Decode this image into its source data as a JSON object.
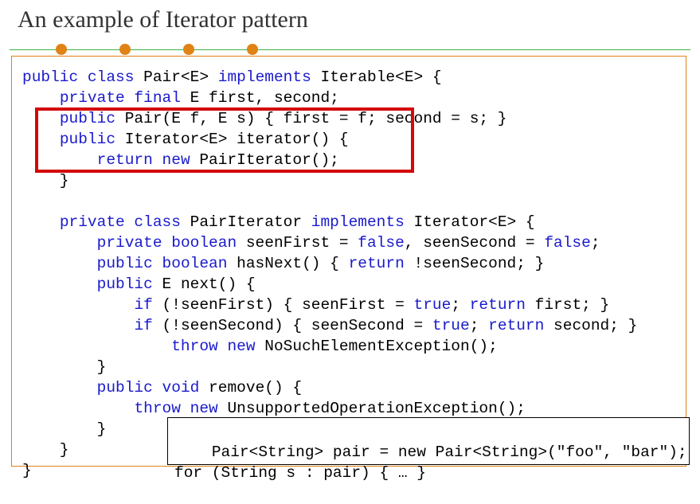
{
  "title": "An example of Iterator pattern",
  "code": {
    "lines": [
      {
        "indent": 0,
        "segs": [
          [
            "public class",
            "kw"
          ],
          [
            " Pair<E> ",
            "plain"
          ],
          [
            "implements",
            "kw"
          ],
          [
            " Iterable<E> {",
            "plain"
          ]
        ]
      },
      {
        "indent": 1,
        "segs": [
          [
            "private final",
            "kw"
          ],
          [
            " E first, second;",
            "plain"
          ]
        ]
      },
      {
        "indent": 1,
        "segs": [
          [
            "public",
            "kw"
          ],
          [
            " Pair(E f, E s) { first = f; second = s; }",
            "plain"
          ]
        ]
      },
      {
        "indent": 1,
        "segs": [
          [
            "public",
            "kw"
          ],
          [
            " Iterator<E> iterator() {",
            "plain"
          ]
        ]
      },
      {
        "indent": 2,
        "segs": [
          [
            "return new",
            "kw"
          ],
          [
            " PairIterator();",
            "plain"
          ]
        ]
      },
      {
        "indent": 1,
        "segs": [
          [
            "}",
            "plain"
          ]
        ]
      },
      {
        "indent": 0,
        "segs": [
          [
            "",
            "plain"
          ]
        ]
      },
      {
        "indent": 1,
        "segs": [
          [
            "private class",
            "kw"
          ],
          [
            " PairIterator ",
            "plain"
          ],
          [
            "implements",
            "kw"
          ],
          [
            " Iterator<E> {",
            "plain"
          ]
        ]
      },
      {
        "indent": 2,
        "segs": [
          [
            "private boolean",
            "kw"
          ],
          [
            " seenFirst = ",
            "plain"
          ],
          [
            "false",
            "kw"
          ],
          [
            ", seenSecond = ",
            "plain"
          ],
          [
            "false",
            "kw"
          ],
          [
            ";",
            "plain"
          ]
        ]
      },
      {
        "indent": 2,
        "segs": [
          [
            "public boolean",
            "kw"
          ],
          [
            " hasNext() { ",
            "plain"
          ],
          [
            "return",
            "kw"
          ],
          [
            " !seenSecond; }",
            "plain"
          ]
        ]
      },
      {
        "indent": 2,
        "segs": [
          [
            "public",
            "kw"
          ],
          [
            " E next() {",
            "plain"
          ]
        ]
      },
      {
        "indent": 3,
        "segs": [
          [
            "if",
            "kw"
          ],
          [
            " (!seenFirst) { seenFirst = ",
            "plain"
          ],
          [
            "true",
            "kw"
          ],
          [
            "; ",
            "plain"
          ],
          [
            "return",
            "kw"
          ],
          [
            " first; }",
            "plain"
          ]
        ]
      },
      {
        "indent": 3,
        "segs": [
          [
            "if",
            "kw"
          ],
          [
            " (!seenSecond) { seenSecond = ",
            "plain"
          ],
          [
            "true",
            "kw"
          ],
          [
            "; ",
            "plain"
          ],
          [
            "return",
            "kw"
          ],
          [
            " second; }",
            "plain"
          ]
        ]
      },
      {
        "indent": 4,
        "segs": [
          [
            "throw new",
            "kw"
          ],
          [
            " NoSuchElementException();",
            "plain"
          ]
        ]
      },
      {
        "indent": 2,
        "segs": [
          [
            "}",
            "plain"
          ]
        ]
      },
      {
        "indent": 2,
        "segs": [
          [
            "public void",
            "kw"
          ],
          [
            " remove() {",
            "plain"
          ]
        ]
      },
      {
        "indent": 3,
        "segs": [
          [
            "throw new",
            "kw"
          ],
          [
            " UnsupportedOperationException();",
            "plain"
          ]
        ]
      },
      {
        "indent": 2,
        "segs": [
          [
            "}",
            "plain"
          ]
        ]
      },
      {
        "indent": 1,
        "segs": [
          [
            "}",
            "plain"
          ]
        ]
      },
      {
        "indent": 0,
        "segs": [
          [
            "}",
            "plain"
          ]
        ]
      }
    ]
  },
  "usage": {
    "line1": "Pair<String> pair = new Pair<String>(\"foo\", \"bar\");",
    "line2": "for (String s : pair) { … }"
  }
}
